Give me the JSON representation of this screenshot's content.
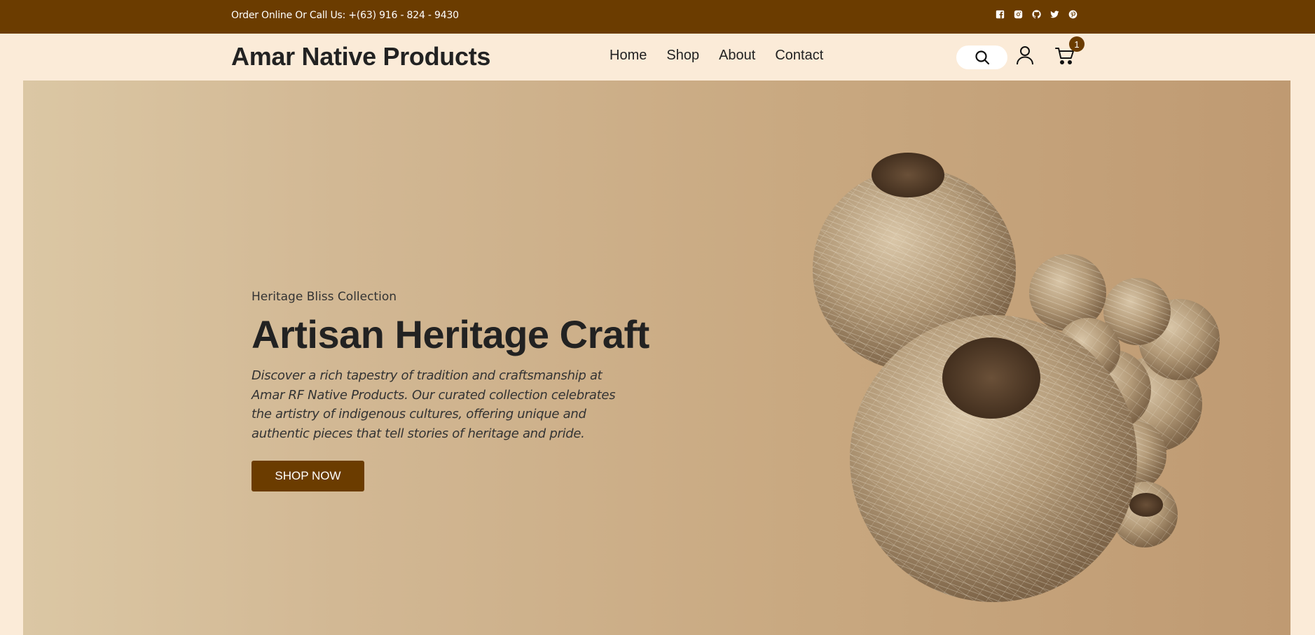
{
  "topbar": {
    "contact_text": "Order Online Or Call Us: +(63) 916 - 824 - 9430",
    "socials": [
      "facebook-icon",
      "instagram-icon",
      "github-icon",
      "twitter-icon",
      "pinterest-icon"
    ]
  },
  "header": {
    "brand": "Amar Native Products",
    "nav": [
      "Home",
      "Shop",
      "About",
      "Contact"
    ],
    "cart_count": "1",
    "icons": [
      "search-icon",
      "user-icon",
      "cart-icon"
    ]
  },
  "hero": {
    "eyebrow": "Heritage Bliss Collection",
    "title": "Artisan Heritage Craft",
    "description": "Discover a rich tapestry of tradition and craftsmanship at Amar RF Native Products. Our curated collection celebrates the artistry of indigenous cultures, offering unique and authentic pieces that tell stories of heritage and pride.",
    "cta": "SHOP NOW"
  },
  "colors": {
    "brand_brown": "#6b3c00",
    "page_bg": "#fbebd8",
    "hero_start": "#dbc7a4",
    "hero_end": "#bf9a72"
  }
}
